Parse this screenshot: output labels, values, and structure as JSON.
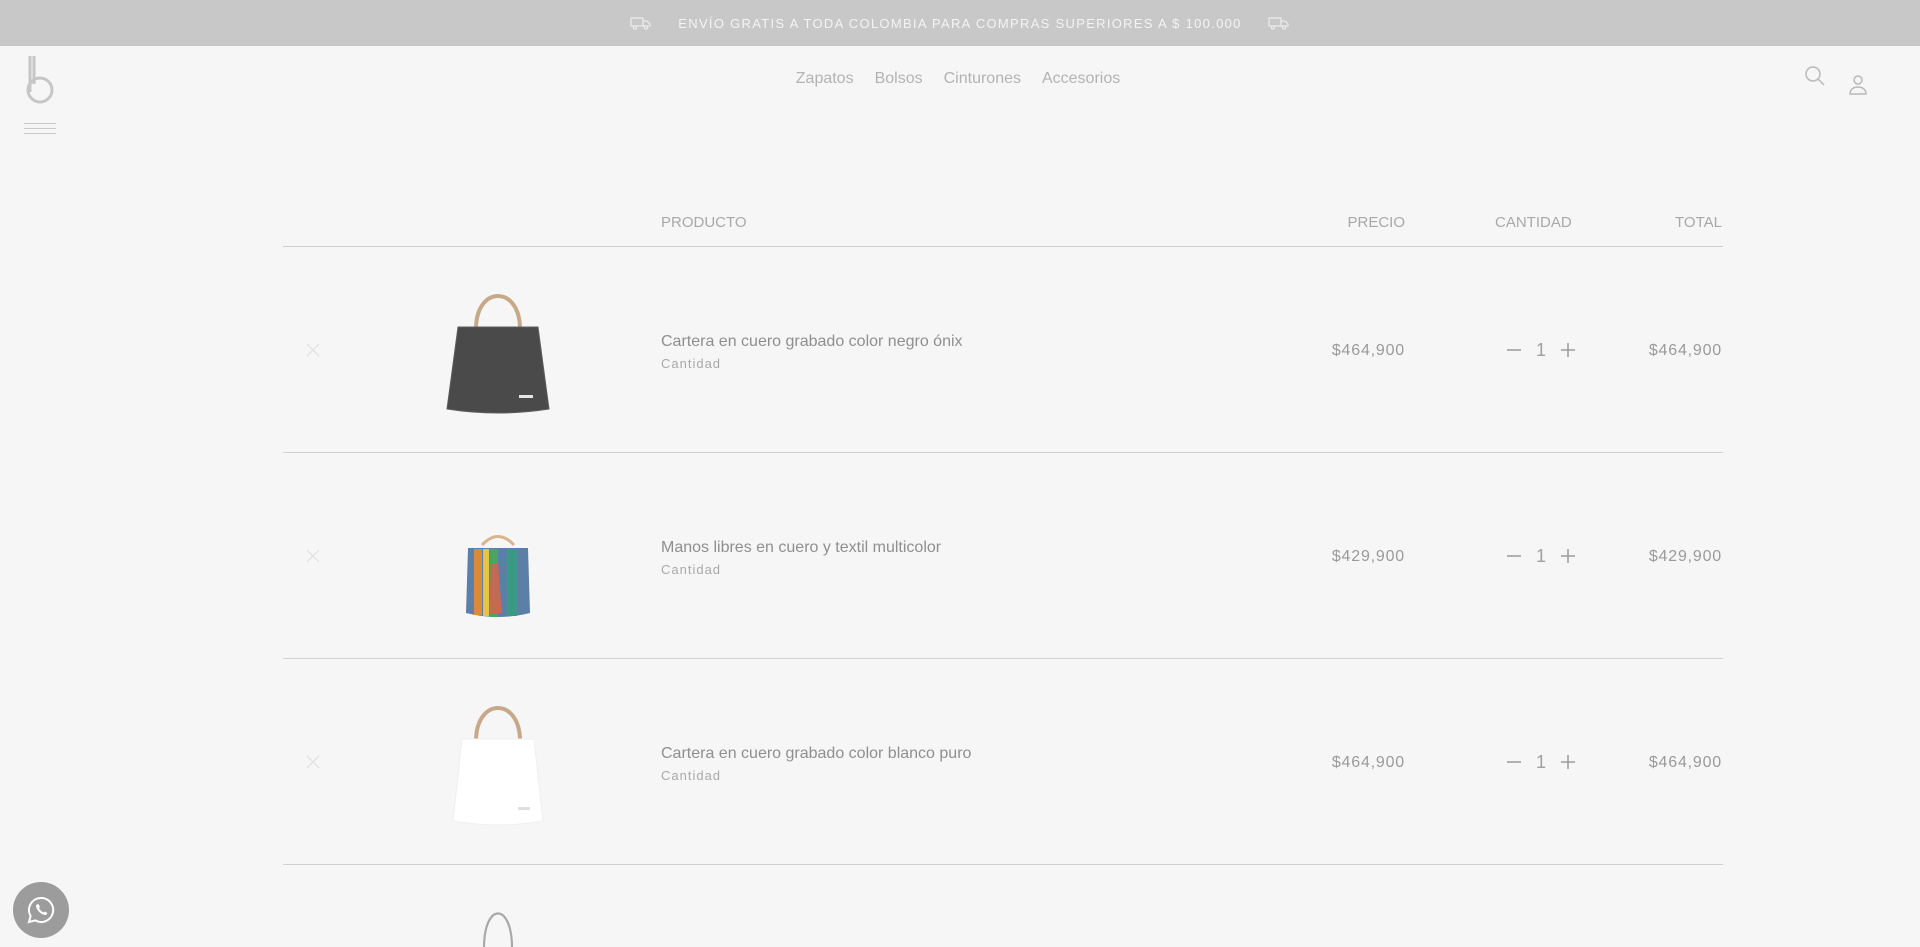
{
  "promo": {
    "text": "ENVÍO GRATIS A TODA COLOMBIA PARA COMPRAS SUPERIORES A $ 100.000",
    "icons": [
      "truck-icon",
      "truck-icon"
    ]
  },
  "header": {
    "logo_icon": "brand-b-logo",
    "menu_icon": "hamburger-icon",
    "nav": [
      "Zapatos",
      "Bolsos",
      "Cinturones",
      "Accesorios"
    ],
    "search_icon": "search-icon",
    "account_icon": "user-icon"
  },
  "table": {
    "headers": {
      "product": "PRODUCTO",
      "price": "PRECIO",
      "quantity": "CANTIDAD",
      "total": "TOTAL"
    },
    "items": [
      {
        "name": "Cartera en cuero grabado color negro ónix",
        "sub": "Cantidad",
        "price": "$464,900",
        "qty": "1",
        "total": "$464,900",
        "image": "black-handbag"
      },
      {
        "name": "Manos libres en cuero y textil multicolor",
        "sub": "Cantidad",
        "price": "$429,900",
        "qty": "1",
        "total": "$429,900",
        "image": "multicolor-bucket-bag"
      },
      {
        "name": "Cartera en cuero grabado color blanco puro",
        "sub": "Cantidad",
        "price": "$464,900",
        "qty": "1",
        "total": "$464,900",
        "image": "white-handbag"
      }
    ],
    "partial_next_image": "handbag-handle-partial"
  },
  "whatsapp_icon": "whatsapp-icon",
  "colors": {
    "overlay_bg": "#f6f6f6",
    "promo_bg": "#c8c8c8",
    "text": "#8a8a8a"
  }
}
